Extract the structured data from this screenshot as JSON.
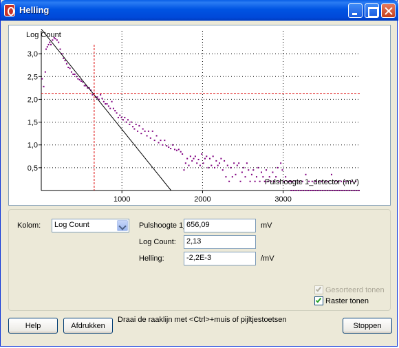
{
  "window": {
    "title": "Helling"
  },
  "chart_data": {
    "type": "scatter",
    "ylabel": "Log Count",
    "xlabel": "Pulshoogte 1_detector (mV)",
    "xlim": [
      0,
      3950
    ],
    "ylim": [
      0,
      3.5
    ],
    "x_ticks": [
      1000,
      2000,
      3000
    ],
    "x_tick_labels": [
      "1000",
      "2000",
      "3000"
    ],
    "y_ticks": [
      0.5,
      1.0,
      1.5,
      2.0,
      2.5,
      3.0
    ],
    "y_tick_labels": [
      "0,5",
      "1,0",
      "1,5",
      "2,0",
      "2,5",
      "3,0"
    ],
    "grid": true,
    "point_color": "#800080",
    "crosshair": {
      "x": 656.09,
      "y": 2.13,
      "color": "#dd0000"
    },
    "tangent_line": {
      "x": [
        0,
        1610
      ],
      "y": [
        3.54,
        0
      ],
      "color": "#000000"
    },
    "points": [
      [
        10,
        2.45
      ],
      [
        30,
        2.28
      ],
      [
        50,
        2.6
      ],
      [
        60,
        3.1
      ],
      [
        75,
        3.15
      ],
      [
        90,
        3.2
      ],
      [
        105,
        3.25
      ],
      [
        120,
        3.2
      ],
      [
        140,
        3.3
      ],
      [
        160,
        3.35
      ],
      [
        175,
        3.33
      ],
      [
        195,
        3.3
      ],
      [
        215,
        3.25
      ],
      [
        235,
        3.1
      ],
      [
        255,
        3.0
      ],
      [
        275,
        2.9
      ],
      [
        295,
        2.85
      ],
      [
        315,
        2.78
      ],
      [
        335,
        2.7
      ],
      [
        355,
        2.68
      ],
      [
        375,
        2.6
      ],
      [
        395,
        2.55
      ],
      [
        415,
        2.55
      ],
      [
        435,
        2.5
      ],
      [
        455,
        2.45
      ],
      [
        475,
        2.43
      ],
      [
        495,
        2.4
      ],
      [
        515,
        2.38
      ],
      [
        535,
        2.3
      ],
      [
        555,
        2.3
      ],
      [
        575,
        2.25
      ],
      [
        595,
        2.25
      ],
      [
        615,
        2.2
      ],
      [
        635,
        2.1
      ],
      [
        655,
        2.13
      ],
      [
        675,
        2.05
      ],
      [
        695,
        2.05
      ],
      [
        715,
        2.0
      ],
      [
        735,
        2.1
      ],
      [
        755,
        2.02
      ],
      [
        775,
        1.95
      ],
      [
        795,
        1.9
      ],
      [
        815,
        1.9
      ],
      [
        835,
        1.85
      ],
      [
        855,
        1.8
      ],
      [
        875,
        1.95
      ],
      [
        895,
        1.8
      ],
      [
        915,
        1.75
      ],
      [
        935,
        1.7
      ],
      [
        955,
        1.6
      ],
      [
        975,
        1.65
      ],
      [
        995,
        1.6
      ],
      [
        1015,
        1.55
      ],
      [
        1035,
        1.6
      ],
      [
        1055,
        1.5
      ],
      [
        1075,
        1.55
      ],
      [
        1095,
        1.45
      ],
      [
        1115,
        1.5
      ],
      [
        1135,
        1.4
      ],
      [
        1155,
        1.35
      ],
      [
        1175,
        1.45
      ],
      [
        1195,
        1.3
      ],
      [
        1215,
        1.42
      ],
      [
        1240,
        1.25
      ],
      [
        1260,
        1.35
      ],
      [
        1285,
        1.3
      ],
      [
        1310,
        1.2
      ],
      [
        1330,
        1.3
      ],
      [
        1355,
        1.15
      ],
      [
        1380,
        1.3
      ],
      [
        1405,
        1.1
      ],
      [
        1430,
        1.2
      ],
      [
        1455,
        1.05
      ],
      [
        1480,
        1.1
      ],
      [
        1505,
        1.0
      ],
      [
        1530,
        1.1
      ],
      [
        1555,
        0.98
      ],
      [
        1580,
        0.95
      ],
      [
        1605,
        0.92
      ],
      [
        1630,
        1.0
      ],
      [
        1655,
        0.9
      ],
      [
        1680,
        0.88
      ],
      [
        1705,
        0.9
      ],
      [
        1730,
        0.85
      ],
      [
        1750,
        0.8
      ],
      [
        1770,
        0.45
      ],
      [
        1790,
        0.6
      ],
      [
        1810,
        0.7
      ],
      [
        1830,
        0.55
      ],
      [
        1850,
        0.75
      ],
      [
        1870,
        0.65
      ],
      [
        1890,
        0.7
      ],
      [
        1910,
        0.75
      ],
      [
        1930,
        0.6
      ],
      [
        1950,
        0.68
      ],
      [
        1970,
        0.55
      ],
      [
        1990,
        0.8
      ],
      [
        2010,
        0.6
      ],
      [
        2030,
        0.7
      ],
      [
        2050,
        0.75
      ],
      [
        2070,
        0.5
      ],
      [
        2090,
        0.7
      ],
      [
        2110,
        0.55
      ],
      [
        2130,
        0.75
      ],
      [
        2150,
        0.5
      ],
      [
        2170,
        0.65
      ],
      [
        2190,
        0.55
      ],
      [
        2210,
        0.6
      ],
      [
        2230,
        0.7
      ],
      [
        2250,
        0.45
      ],
      [
        2270,
        0.65
      ],
      [
        2290,
        0.3
      ],
      [
        2310,
        0.55
      ],
      [
        2330,
        0.2
      ],
      [
        2350,
        0.5
      ],
      [
        2370,
        0.3
      ],
      [
        2390,
        0.6
      ],
      [
        2410,
        0.35
      ],
      [
        2430,
        0.55
      ],
      [
        2450,
        0.6
      ],
      [
        2470,
        0.2
      ],
      [
        2490,
        0.4
      ],
      [
        2510,
        0.5
      ],
      [
        2530,
        0.3
      ],
      [
        2550,
        0.6
      ],
      [
        2570,
        0.45
      ],
      [
        2590,
        0.2
      ],
      [
        2610,
        0.35
      ],
      [
        2630,
        0.45
      ],
      [
        2650,
        0.2
      ],
      [
        2670,
        0.3
      ],
      [
        2690,
        0.5
      ],
      [
        2710,
        0.2
      ],
      [
        2730,
        0.4
      ],
      [
        2750,
        0.3
      ],
      [
        2770,
        0.2
      ],
      [
        2790,
        0.45
      ],
      [
        2810,
        0.2
      ],
      [
        2830,
        0.3
      ],
      [
        2850,
        0.2
      ],
      [
        2870,
        0.4
      ],
      [
        2890,
        0.2
      ],
      [
        2910,
        0.3
      ],
      [
        2930,
        0.5
      ],
      [
        2950,
        0.2
      ],
      [
        2970,
        0.6
      ],
      [
        2990,
        0.45
      ],
      [
        3010,
        0.2
      ],
      [
        3030,
        0.3
      ],
      [
        3050,
        0.2
      ],
      [
        3070,
        0.2
      ],
      [
        3090,
        0.2
      ],
      [
        3110,
        0.2
      ],
      [
        3150,
        0.2
      ],
      [
        3200,
        0.2
      ],
      [
        3240,
        0.2
      ],
      [
        3280,
        0.35
      ],
      [
        3320,
        0.2
      ],
      [
        3360,
        0.2
      ],
      [
        3400,
        0.2
      ],
      [
        3440,
        0.2
      ],
      [
        3480,
        0.2
      ],
      [
        3520,
        0.2
      ],
      [
        3560,
        0.2
      ],
      [
        3600,
        0.35
      ],
      [
        3640,
        0.2
      ],
      [
        3680,
        0.2
      ],
      [
        3720,
        0.2
      ],
      [
        3760,
        0.2
      ],
      [
        3800,
        0.2
      ],
      [
        3850,
        0.2
      ],
      [
        3900,
        0.2
      ],
      [
        3100,
        0.0
      ],
      [
        3130,
        0.0
      ],
      [
        3160,
        0.0
      ],
      [
        3190,
        0.0
      ],
      [
        3220,
        0.0
      ],
      [
        3250,
        0.0
      ],
      [
        3280,
        0.0
      ],
      [
        3310,
        0.0
      ],
      [
        3340,
        0.0
      ],
      [
        3370,
        0.0
      ],
      [
        3400,
        0.0
      ],
      [
        3430,
        0.0
      ],
      [
        3460,
        0.0
      ],
      [
        3490,
        0.0
      ],
      [
        3520,
        0.0
      ],
      [
        3550,
        0.0
      ],
      [
        3580,
        0.0
      ],
      [
        3610,
        0.0
      ],
      [
        3640,
        0.0
      ],
      [
        3670,
        0.0
      ],
      [
        3700,
        0.0
      ],
      [
        3730,
        0.0
      ],
      [
        3760,
        0.0
      ],
      [
        3790,
        0.0
      ],
      [
        3820,
        0.0
      ],
      [
        3850,
        0.0
      ],
      [
        3880,
        0.0
      ],
      [
        3910,
        0.0
      ],
      [
        3940,
        0.0
      ]
    ]
  },
  "controls": {
    "kolom_label": "Kolom:",
    "kolom_value": "Log Count",
    "pulshoogte_label": "Pulshoogte 1_",
    "pulshoogte_value": "656,09",
    "pulshoogte_unit": "mV",
    "logcount_label": "Log Count:",
    "logcount_value": "2,13",
    "helling_label": "Helling:",
    "helling_value": "-2,2E-3",
    "helling_unit": "/mV",
    "gesorteerd_label": "Gesorteerd tonen",
    "gesorteerd_checked": true,
    "gesorteerd_disabled": true,
    "raster_label": "Raster tonen",
    "raster_checked": true
  },
  "buttons": {
    "help": "Help",
    "afdrukken": "Afdrukken",
    "stoppen": "Stoppen"
  },
  "hint": "Draai de raaklijn met <Ctrl>+muis of pijltjestoetsen"
}
